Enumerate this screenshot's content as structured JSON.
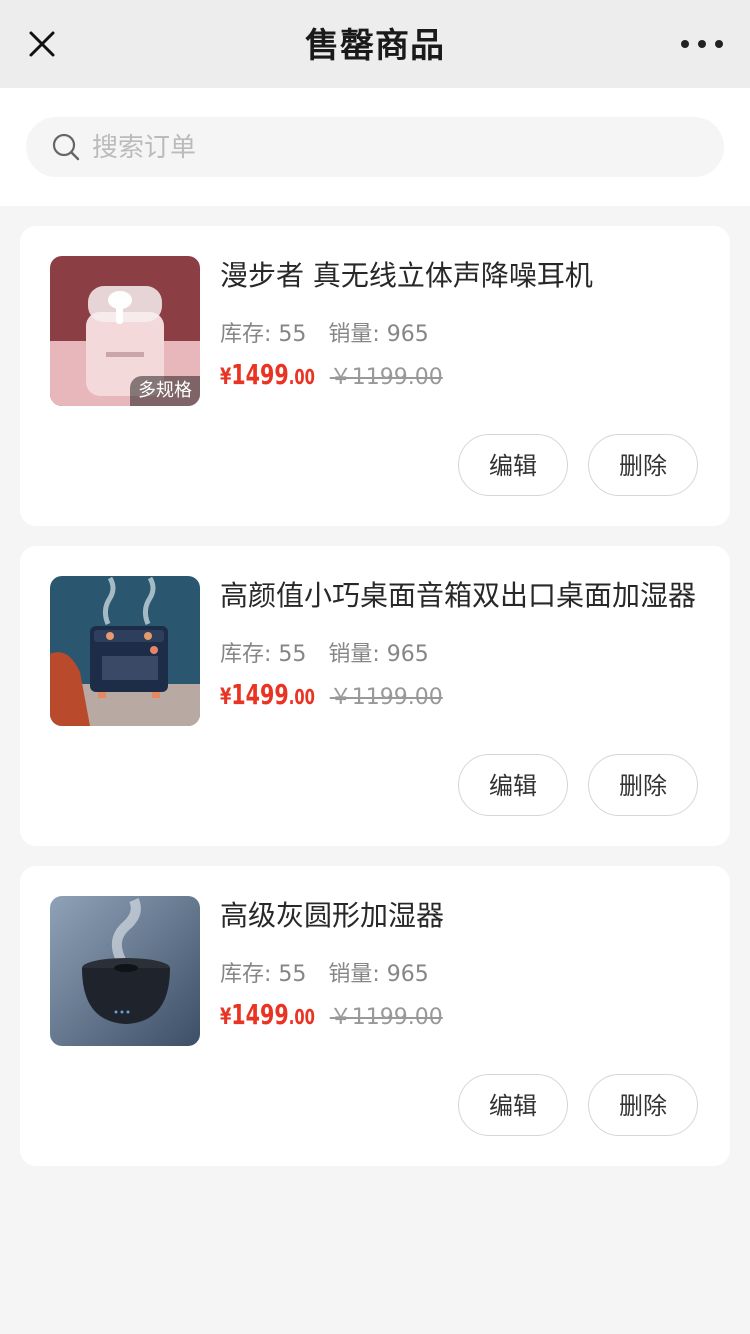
{
  "nav": {
    "title": "售罄商品",
    "close_icon": "close-icon",
    "more_icon": "more-dots-icon"
  },
  "search": {
    "placeholder": "搜索订单",
    "value": "",
    "icon": "search-icon"
  },
  "colors": {
    "price": "#e93323",
    "background": "#f5f5f5"
  },
  "products": [
    {
      "title": "漫步者 真无线立体声降噪耳机",
      "spec_tag": "多规格",
      "stock_label": "库存: 55",
      "sales_label": "销量: 965",
      "price_symbol": "¥",
      "price_int": "1499",
      "price_dec": ".00",
      "original_price": "￥1199.00",
      "edit_label": "编辑",
      "delete_label": "删除"
    },
    {
      "title": "高颜值小巧桌面音箱双出口桌面加湿器",
      "stock_label": "库存: 55",
      "sales_label": "销量: 965",
      "price_symbol": "¥",
      "price_int": "1499",
      "price_dec": ".00",
      "original_price": "￥1199.00",
      "edit_label": "编辑",
      "delete_label": "删除"
    },
    {
      "title": "高级灰圆形加湿器",
      "stock_label": "库存: 55",
      "sales_label": "销量: 965",
      "price_symbol": "¥",
      "price_int": "1499",
      "price_dec": ".00",
      "original_price": "￥1199.00",
      "edit_label": "编辑",
      "delete_label": "删除"
    }
  ]
}
